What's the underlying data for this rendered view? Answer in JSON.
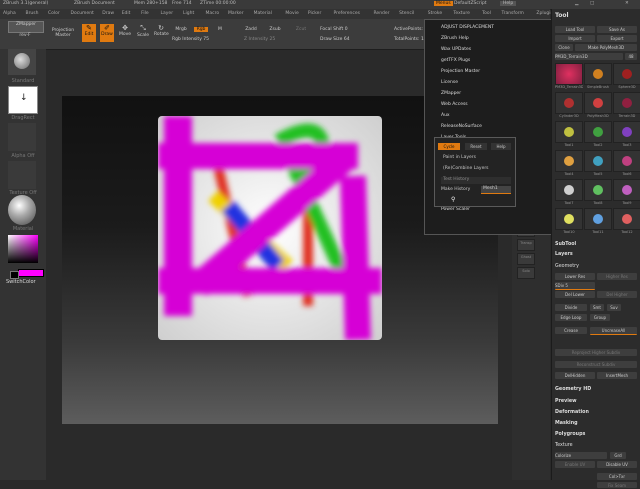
{
  "titlebar": {
    "app": "ZBrush 3.1(general)",
    "doc": "ZBrush Document",
    "mem": "Mem 280+158",
    "free": "Free 714",
    "timer": "ZTime 00:00:00",
    "menus_btn": "Menus",
    "script_btn": "DefaultZScript",
    "help_btn": "Help"
  },
  "menubar": [
    "Alpha",
    "Brush",
    "Color",
    "Document",
    "Draw",
    "Edit",
    "File",
    "Layer",
    "Light",
    "Macro",
    "Marker",
    "Material",
    "Movie",
    "Picker",
    "Preferences",
    "Render",
    "Stencil",
    "Stroke",
    "Texture",
    "Tool",
    "Transform",
    "Zplugin",
    "Zscript"
  ],
  "toolbar": {
    "zmapper": "ZMapper",
    "zmapper_sub": "rev-F",
    "projection_master": "Projection Master",
    "edit": "Edit",
    "draw": "Draw",
    "move": "Move",
    "scale": "Scale",
    "rotate": "Rotate",
    "mrgb": "Mrgb",
    "rgb": "Rgb",
    "m": "M",
    "rgb_intensity": "Rgb Intensity 75",
    "zadd": "Zadd",
    "zsub": "Zsub",
    "zcut": "Zcut",
    "z_intensity": "Z Intensity 25",
    "focal_shift": "Focal Shift 0",
    "draw_size": "Draw Size 64",
    "active_points": "ActivePoints: 94,594",
    "total_points": "TotalPoints: 1.414 Mil"
  },
  "leftcol": [
    "Standard",
    "DragRect",
    "Alpha Off",
    "Texture Off",
    "Material",
    "SwitchColor"
  ],
  "popup": {
    "items": [
      "ADJUST DISPLACEMENT",
      "ZBrush Help",
      "Wax UPDates",
      "getTFX Plugs",
      "Projection Master",
      "License",
      "ZMapper",
      "Web Access",
      "Aux",
      "ReleaseNoSurface",
      "Layer Tools",
      "Power Scaler"
    ],
    "submenu": {
      "tabs": [
        "Cycle",
        "Reset",
        "Help"
      ],
      "items": [
        "Paint in Layers",
        "(Re)Combine Layers",
        "Test History",
        "Make History",
        "Mesh1"
      ]
    }
  },
  "rightstrip": [
    "Scroll",
    "Zoom",
    "Actual",
    "AAHalf",
    "Persp",
    "Floor",
    "Local",
    "L.Sym",
    "Xyz",
    "Frame",
    "Move",
    "Scale",
    "Rotate",
    "PolyF",
    "Transp",
    "Ghost",
    "Solo"
  ],
  "tool_panel": {
    "title": "Tool",
    "load": "Load Tool",
    "save": "Save As",
    "import": "Import",
    "export": "Export",
    "clone": "Clone",
    "make_poly": "Make PolyMesh3D",
    "current": "PM3D_Terrain3D",
    "tool_count": "48",
    "tools": [
      "PM3D_Terrain3D",
      "SimpleBrush",
      "Sphere3D",
      "Cylinder3D",
      "PolyMesh3D",
      "Terrain3D",
      "Tool1",
      "Tool2",
      "Tool3",
      "Tool4",
      "Tool5",
      "Tool6",
      "Tool7",
      "Tool8",
      "Tool9",
      "Tool10",
      "Tool11",
      "Tool12"
    ],
    "subtool": "SubTool",
    "layers": "Layers",
    "geometry": "Geometry",
    "lower_res": "Lower Res",
    "higher_res": "Higher Res",
    "sdiv": "SDiv 5",
    "del_lower": "Del Lower",
    "del_higher": "Del Higher",
    "divide": "Divide",
    "smt": "Smt",
    "suv": "Suv",
    "edge_loop": "Edge Loop",
    "group": "Group",
    "reproject": "Reproject Higher Subdiv",
    "reconstruct": "Reconstruct Subdiv",
    "del_hidden": "DelHidden",
    "insert_mesh": "InsertMesh",
    "uncreaseall": "UncreaseAll",
    "crease": "Crease",
    "geometry_hd": "Geometry HD",
    "preview": "Preview",
    "deformation": "Deformation",
    "masking": "Masking",
    "polygroups": "Polygroups",
    "texture": "Texture",
    "colorize": "Colorize",
    "grd": "Grd",
    "enable_uv": "Enable UV",
    "disable_uv": "Disable UV",
    "col_tex": "Col>Txr",
    "fix_seam": "Fix Seam"
  },
  "colors": {
    "accent": "#e07a10",
    "magenta": "#d600d6",
    "green": "#20c020"
  }
}
